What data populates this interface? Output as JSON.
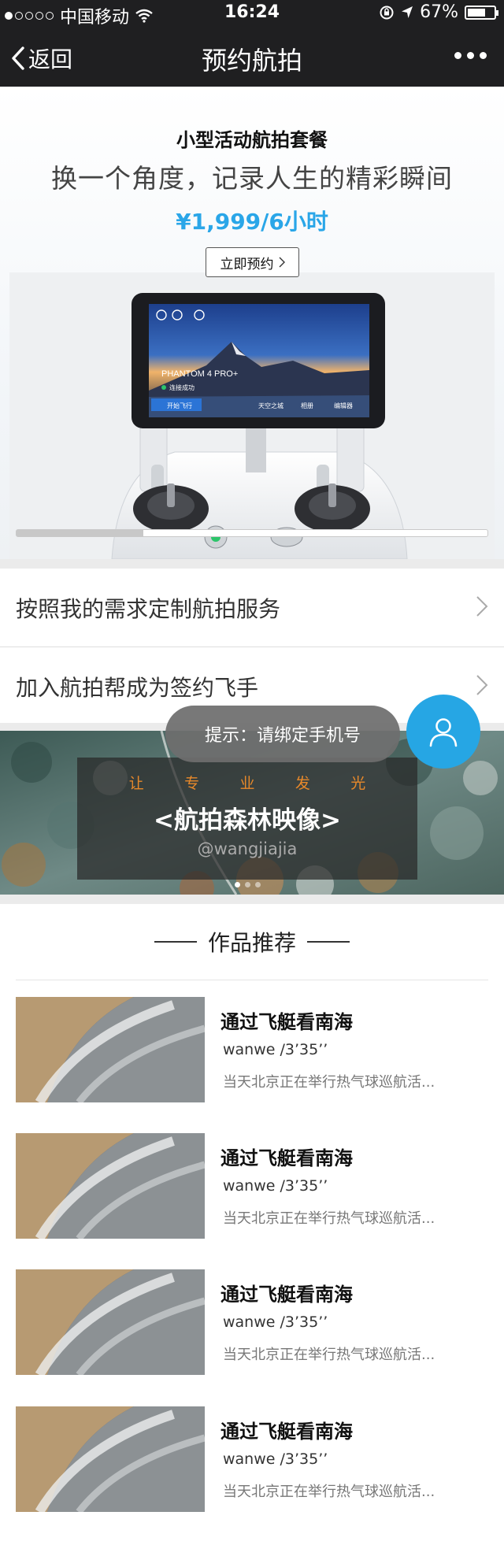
{
  "status_bar": {
    "carrier": "中国移动",
    "time": "16:24",
    "battery": "67%"
  },
  "nav": {
    "back_label": "返回",
    "title": "预约航拍"
  },
  "hero": {
    "subtitle": "小型活动航拍套餐",
    "slogan": "换一个角度，记录人生的精彩瞬间",
    "price": "¥1,999/6小时",
    "book_label": "立即预约",
    "screen_brand": "PHANTOM 4 PRO+",
    "screen_status": "连接成功",
    "screen_start": "开始飞行",
    "screen_tab1": "天空之城",
    "screen_tab2": "相册",
    "screen_tab3": "编辑器",
    "carousel_progress": 0.27
  },
  "menu": {
    "items": [
      {
        "label": "按照我的需求定制航拍服务"
      },
      {
        "label": "加入航拍帮成为签约飞手"
      }
    ]
  },
  "banner": {
    "tagline": [
      "让",
      "专",
      "业",
      "发",
      "光"
    ],
    "name": "<航拍森林映像>",
    "handle": "@wangjiajia"
  },
  "toast": {
    "text": "提示：请绑定手机号"
  },
  "works": {
    "title": "作品推荐",
    "items": [
      {
        "title": "通过飞艇看南海",
        "meta": "wanwe /3’35’’",
        "desc": "当天北京正在举行热气球巡航活..."
      },
      {
        "title": "通过飞艇看南海",
        "meta": "wanwe /3’35’’",
        "desc": "当天北京正在举行热气球巡航活..."
      },
      {
        "title": "通过飞艇看南海",
        "meta": "wanwe /3’35’’",
        "desc": "当天北京正在举行热气球巡航活..."
      },
      {
        "title": "通过飞艇看南海",
        "meta": "wanwe /3’35’’",
        "desc": "当天北京正在举行热气球巡航活..."
      }
    ]
  },
  "colors": {
    "accent": "#2aa6e8",
    "nav_bg": "#1f1f21",
    "tagline": "#e8892a"
  }
}
